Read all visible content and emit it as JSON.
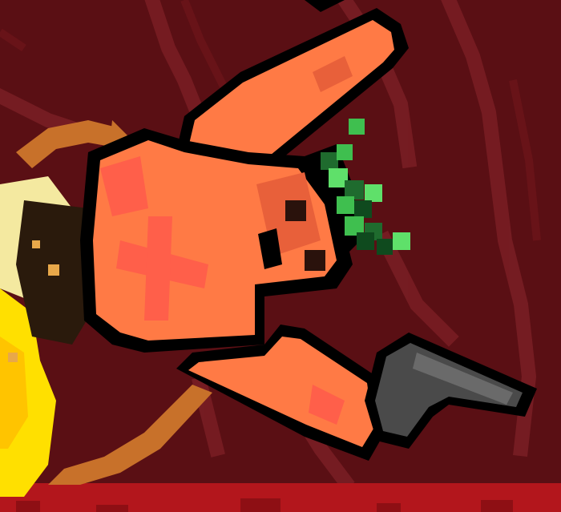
{
  "scene": {
    "description_free": true,
    "background_color": "#5a0f14",
    "vein_color": "#7a1e24",
    "floor_color": "#b3161c",
    "floor_dark_color": "#8e0f14",
    "character": {
      "body_color": "#ff7a45",
      "body_shade_color": "#e8603a",
      "body_highlight_color": "#ff5f4a",
      "outline_color": "#000000",
      "leaf_colors": [
        "#1f6b2e",
        "#3fbf4f",
        "#5fe06a",
        "#0f4a1e"
      ],
      "eye_color": "#2a120c"
    },
    "weapon": {
      "icon": "pistol-icon",
      "color": "#4a4a4a",
      "highlight_color": "#6a6a6a"
    },
    "effects": {
      "explosion_colors": [
        "#ffe000",
        "#ffc400",
        "#f4e9a0",
        "#e8a84a",
        "#2a1a0c"
      ],
      "rope_color": "#c8712a"
    }
  }
}
